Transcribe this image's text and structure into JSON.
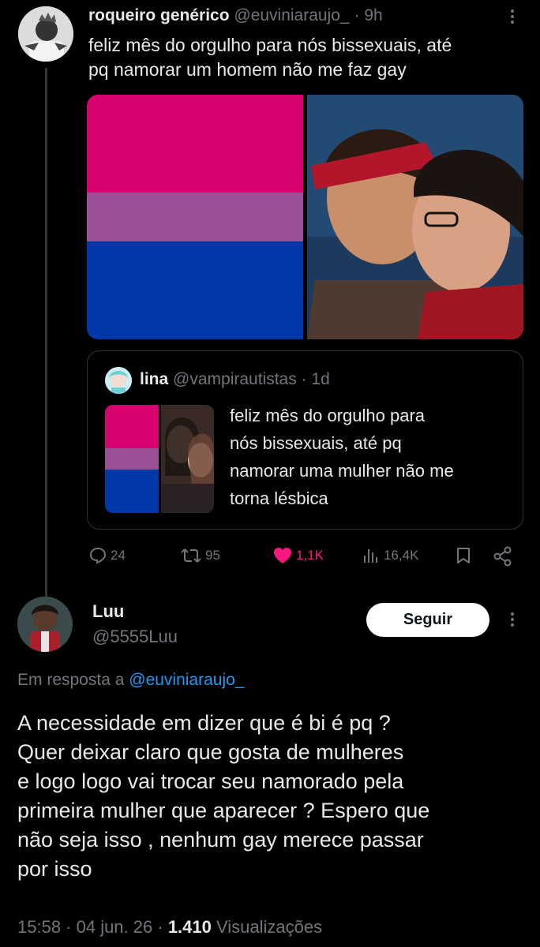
{
  "tweet1": {
    "display_name": "roqueiro genérico",
    "handle": "@euviniaraujo_",
    "time_sep": "·",
    "time": "9h",
    "text_line1": "feliz mês do orgulho para nós bissexuais, até",
    "text_line2": "pq namorar um homem não me faz gay",
    "flag_colors": [
      "#d60270",
      "#9b4f96",
      "#0038a8"
    ],
    "quote": {
      "display_name": "lina",
      "handle": "@vampirautistas",
      "time_sep": "·",
      "time": "1d",
      "text_lines": [
        "feliz mês do orgulho para",
        "nós bissexuais, até pq",
        "namorar uma mulher não me",
        "torna lésbica"
      ]
    },
    "actions": {
      "replies": "24",
      "retweets": "95",
      "likes": "1,1K",
      "views": "16,4K"
    },
    "like_color": "#f91880"
  },
  "tweet2": {
    "display_name": "Luu",
    "handle": "@5555Luu",
    "follow_label": "Seguir",
    "reply_prefix": "Em resposta a",
    "reply_to": "@euviniaraujo_",
    "text_lines": [
      "A necessidade em dizer que é bi é pq ?",
      "Quer deixar claro que gosta de mulheres",
      "e logo logo vai trocar seu namorado pela",
      "primeira mulher que aparecer ? Espero que",
      "não seja isso , nenhum gay merece passar",
      "por isso"
    ],
    "timestamp": "15:58 · 04 jun. 26 ·",
    "views_count": "1.410",
    "views_label": "Visualizações"
  },
  "accent_color": "#1d9bf0"
}
